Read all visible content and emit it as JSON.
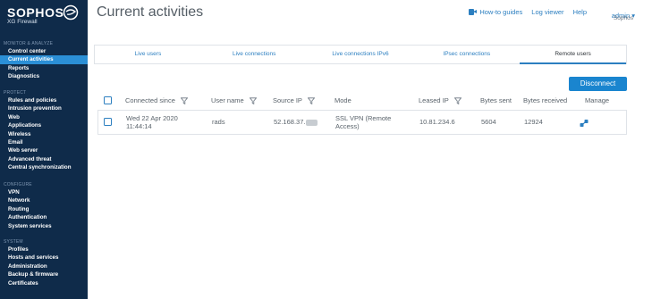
{
  "brand": {
    "name": "SOPHOS",
    "product": "XG Firewall"
  },
  "header": {
    "title": "Current activities",
    "links": [
      {
        "label": "How-to guides",
        "icon": "video-camera-icon"
      },
      {
        "label": "Log viewer"
      },
      {
        "label": "Help"
      }
    ],
    "admin": "admin ▾",
    "org": "Sophos"
  },
  "sidebar": {
    "groups": [
      {
        "heading": "MONITOR & ANALYZE",
        "items": [
          {
            "label": "Control center"
          },
          {
            "label": "Current activities",
            "active": true
          },
          {
            "label": "Reports"
          },
          {
            "label": "Diagnostics"
          }
        ]
      },
      {
        "heading": "PROTECT",
        "items": [
          {
            "label": "Rules and policies"
          },
          {
            "label": "Intrusion prevention"
          },
          {
            "label": "Web"
          },
          {
            "label": "Applications"
          },
          {
            "label": "Wireless"
          },
          {
            "label": "Email"
          },
          {
            "label": "Web server"
          },
          {
            "label": "Advanced threat"
          },
          {
            "label": "Central synchronization"
          }
        ]
      },
      {
        "heading": "CONFIGURE",
        "items": [
          {
            "label": "VPN"
          },
          {
            "label": "Network"
          },
          {
            "label": "Routing"
          },
          {
            "label": "Authentication"
          },
          {
            "label": "System services"
          }
        ]
      },
      {
        "heading": "SYSTEM",
        "items": [
          {
            "label": "Profiles"
          },
          {
            "label": "Hosts and services"
          },
          {
            "label": "Administration"
          },
          {
            "label": "Backup & firmware"
          },
          {
            "label": "Certificates"
          }
        ]
      }
    ]
  },
  "tabs": [
    {
      "label": "Live users"
    },
    {
      "label": "Live connections"
    },
    {
      "label": "Live connections IPv6"
    },
    {
      "label": "IPsec connections"
    },
    {
      "label": "Remote users",
      "active": true
    }
  ],
  "toolbar": {
    "disconnect_label": "Disconnect"
  },
  "table": {
    "columns": [
      "Connected since",
      "User name",
      "Source IP",
      "Mode",
      "Leased IP",
      "Bytes sent",
      "Bytes received",
      "Manage"
    ],
    "rows": [
      {
        "connected_since": [
          "Wed 22 Apr 2020",
          "11:44:14"
        ],
        "user_name": "rads",
        "source_ip": "52.168.37.",
        "mode": [
          "SSL VPN (Remote",
          "Access)"
        ],
        "leased_ip": "10.81.234.6",
        "bytes_sent": "5604",
        "bytes_received": "12924"
      }
    ]
  },
  "colors": {
    "sidebar": "#0f2b4a",
    "accent": "#2c7fc0",
    "active": "#2b8fd6"
  }
}
